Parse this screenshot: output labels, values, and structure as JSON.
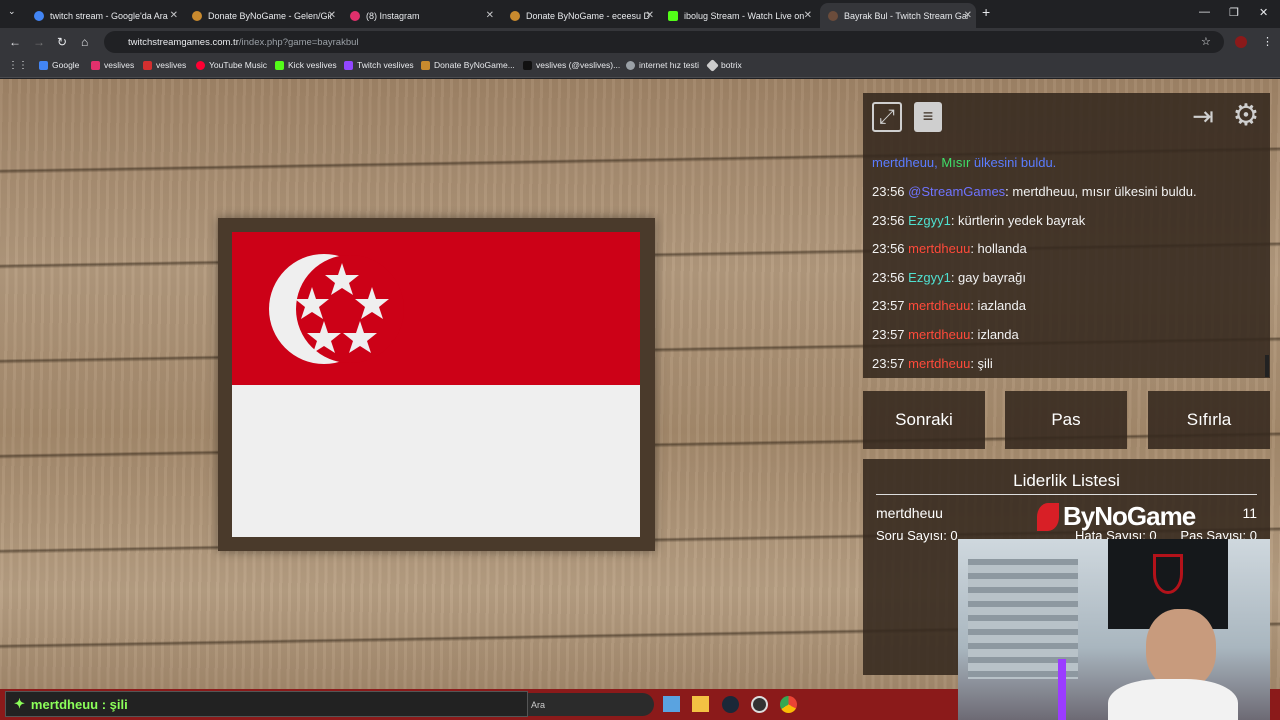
{
  "tabs": [
    {
      "title": "twitch stream - Google'da Ara",
      "color": "#4285f4"
    },
    {
      "title": "Donate ByNoGame - Gelen/Gid",
      "color": "#c98a2e"
    },
    {
      "title": "(8) Instagram",
      "color": "#e1306c"
    },
    {
      "title": "Donate ByNoGame - eceesu De",
      "color": "#c98a2e"
    },
    {
      "title": "ibolug Stream - Watch Live on",
      "color": "#53fc18"
    },
    {
      "title": "Bayrak Bul - Twitch Stream Gam",
      "color": "#6b4c3b"
    }
  ],
  "url": {
    "host": "twitchstreamgames.com.tr",
    "path": "/index.php?game=bayrakbul"
  },
  "bookmarks": [
    {
      "label": "Google",
      "color": "#4285f4"
    },
    {
      "label": "veslives",
      "color": "#e1306c"
    },
    {
      "label": "veslives",
      "color": "#d32f2f"
    },
    {
      "label": "YouTube Music",
      "color": "#ff0033"
    },
    {
      "label": "Kick veslives",
      "color": "#53fc18"
    },
    {
      "label": "Twitch veslives",
      "color": "#9146ff"
    },
    {
      "label": "Donate ByNoGame...",
      "color": "#c98a2e"
    },
    {
      "label": "veslives (@veslives)...",
      "color": "#111111"
    },
    {
      "label": "internet hız testi",
      "color": "#9aa0a6"
    },
    {
      "label": "botrix",
      "color": "#cccccc"
    }
  ],
  "chat": {
    "top_line": {
      "user": "mertdheuu,",
      "country": "Mısır",
      "rest": "ülkesini buldu."
    },
    "messages": [
      {
        "time": "23:56",
        "user": "@StreamGames",
        "user_color": "#6f74ff",
        "text": ": mertdheuu, mısır ülkesini buldu."
      },
      {
        "time": "23:56",
        "user": "Ezgyy1",
        "user_color": "#4fe0d0",
        "text": ": kürtlerin yedek bayrak"
      },
      {
        "time": "23:56",
        "user": "mertdheuu",
        "user_color": "#ff4a3a",
        "text": ": hollanda"
      },
      {
        "time": "23:56",
        "user": "Ezgyy1",
        "user_color": "#4fe0d0",
        "text": ": gay bayrağı"
      },
      {
        "time": "23:57",
        "user": "mertdheuu",
        "user_color": "#ff4a3a",
        "text": ": iazlanda"
      },
      {
        "time": "23:57",
        "user": "mertdheuu",
        "user_color": "#ff4a3a",
        "text": ": izlanda"
      },
      {
        "time": "23:57",
        "user": "mertdheuu",
        "user_color": "#ff4a3a",
        "text": ": şili"
      }
    ]
  },
  "buttons": {
    "next": "Sonraki",
    "pass": "Pas",
    "reset": "Sıfırla"
  },
  "leaderboard": {
    "title": "Liderlik Listesi",
    "name": "mertdheuu",
    "score": "11",
    "questions": "Soru Sayısı: 0",
    "errors": "Hata Sayısı: 0",
    "passes": "Pas Sayısı: 0"
  },
  "overlay": {
    "logo": "ByNoGame",
    "alert": "mertdheuu : şili"
  },
  "taskbar": {
    "search": "Ara"
  }
}
